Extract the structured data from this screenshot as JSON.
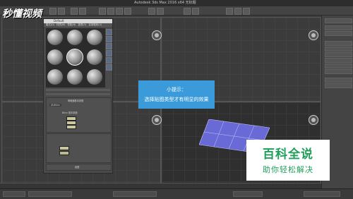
{
  "app": {
    "title": "Autodesk 3ds Max 2016 x64    无标题"
  },
  "material_editor": {
    "title": "Default",
    "menu": [
      "模式(D)",
      "材质(M)",
      "导航(N)",
      "选项(O)",
      "实用程序(U)"
    ],
    "basic_rollout": "Blinn 基本参数",
    "shader_label": "明暗器基本参数",
    "shader_value": "(B)Blinn",
    "map_rollout": "贴图",
    "swatch_colors": [
      "#c9c6a0",
      "#bdb98f"
    ]
  },
  "tooltip": {
    "line1": "小提示：",
    "line2": "选择贴图类型才有明显的效果",
    "color": "#3b9bda"
  },
  "plane": {
    "color": "#6a6ad6"
  },
  "watermarks": {
    "top_left": "秒懂视频",
    "bottom_right_main": "百科全说",
    "bottom_right_sub": "助你轻松解决",
    "brand_color": "#1f9f5a"
  }
}
